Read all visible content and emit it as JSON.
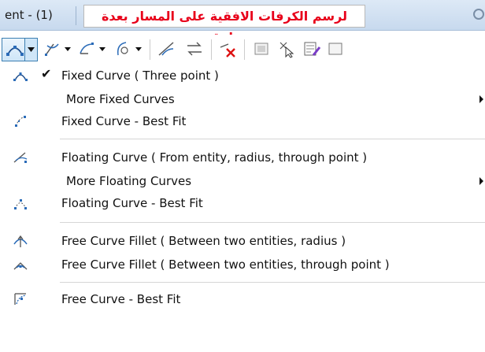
{
  "window": {
    "title": "ent - (1)",
    "banner_text": "لرسم الكرفات الافقية على المسار بعدة طرق"
  },
  "toolbar": {
    "buttons": [
      {
        "icon": "arc-three-point-icon",
        "has_dropdown": true
      },
      {
        "icon": "line-arc-icon",
        "has_dropdown": true
      },
      {
        "icon": "arc-tangent-icon",
        "has_dropdown": true
      },
      {
        "icon": "spiral-arc-icon",
        "has_dropdown": true
      },
      {
        "icon": "fillet-icon",
        "has_dropdown": false
      },
      {
        "icon": "reverse-direction-icon",
        "has_dropdown": false
      },
      {
        "icon": "delete-element-icon",
        "has_dropdown": false
      },
      {
        "icon": "properties-icon",
        "has_dropdown": false
      },
      {
        "icon": "select-pointer-icon",
        "has_dropdown": false
      },
      {
        "icon": "edit-table-icon",
        "has_dropdown": false
      }
    ]
  },
  "menu": {
    "items": [
      {
        "label": "Fixed Curve ( Three point )",
        "checked": true,
        "icon": "arc-three-point-icon",
        "submenu": false
      },
      {
        "label": "More Fixed Curves",
        "checked": false,
        "icon": "",
        "submenu": true
      },
      {
        "label": "Fixed Curve - Best Fit",
        "checked": false,
        "icon": "best-fit-points-icon",
        "submenu": false
      },
      {
        "label": "Floating Curve ( From entity, radius, through point )",
        "checked": false,
        "icon": "floating-curve-icon",
        "submenu": false
      },
      {
        "label": "More Floating Curves",
        "checked": false,
        "icon": "",
        "submenu": true
      },
      {
        "label": "Floating Curve - Best Fit",
        "checked": false,
        "icon": "floating-best-fit-icon",
        "submenu": false
      },
      {
        "label": "Free Curve Fillet ( Between two entities, radius )",
        "checked": false,
        "icon": "fillet-radius-icon",
        "submenu": false
      },
      {
        "label": "Free Curve Fillet ( Between two entities, through point )",
        "checked": false,
        "icon": "fillet-through-point-icon",
        "submenu": false
      },
      {
        "label": "Free Curve - Best Fit",
        "checked": false,
        "icon": "free-curve-best-fit-icon",
        "submenu": false
      }
    ],
    "check_glyph": "✔"
  },
  "colors": {
    "banner_text": "#e8001a",
    "title_bar": "#c7d9ee",
    "accent": "#3c7fb1"
  }
}
